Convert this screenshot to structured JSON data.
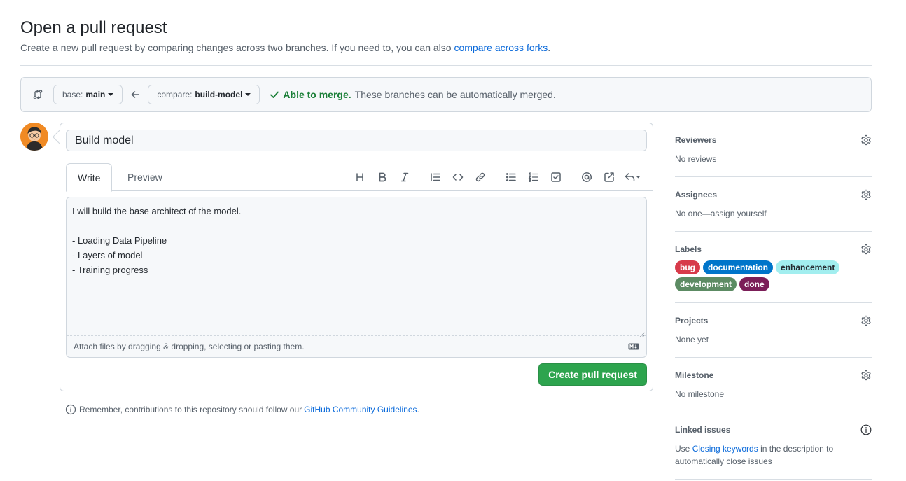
{
  "header": {
    "title": "Open a pull request",
    "subtitle": "Create a new pull request by comparing changes across two branches. If you need to, you can also ",
    "subtitle_link": "compare across forks",
    "subtitle_end": "."
  },
  "range": {
    "base_prefix": "base:",
    "base_branch": "main",
    "compare_prefix": "compare:",
    "compare_branch": "build-model",
    "merge_status": "Able to merge.",
    "merge_message": "These branches can be automatically merged."
  },
  "composer": {
    "title_value": "Build model",
    "tabs": [
      {
        "label": "Write"
      },
      {
        "label": "Preview"
      }
    ],
    "body_value": "I will build the base architect of the model.\n\n- Loading Data Pipeline\n- Layers of model\n- Training progress",
    "attach_hint": "Attach files by dragging & dropping, selecting or pasting them.",
    "submit_label": "Create pull request"
  },
  "toolbar_icons": [
    "heading-icon",
    "bold-icon",
    "italic-icon",
    "quote-icon",
    "code-icon",
    "link-icon",
    "unordered-list-icon",
    "ordered-list-icon",
    "task-list-icon",
    "mention-icon",
    "cross-reference-icon",
    "reply-icon"
  ],
  "tip": {
    "text": "Remember, contributions to this repository should follow our ",
    "link": "GitHub Community Guidelines",
    "end": "."
  },
  "sidebar": {
    "reviewers": {
      "heading": "Reviewers",
      "value": "No reviews"
    },
    "assignees": {
      "heading": "Assignees",
      "value": "No one—assign yourself"
    },
    "labels": {
      "heading": "Labels",
      "items": [
        {
          "name": "bug",
          "bg": "#d73a4a",
          "fg": "#ffffff"
        },
        {
          "name": "documentation",
          "bg": "#0075ca",
          "fg": "#ffffff"
        },
        {
          "name": "enhancement",
          "bg": "#a2eeef",
          "fg": "#24292f"
        },
        {
          "name": "development",
          "bg": "#5c8b63",
          "fg": "#ffffff"
        },
        {
          "name": "done",
          "bg": "#7b1e58",
          "fg": "#ffffff"
        }
      ]
    },
    "projects": {
      "heading": "Projects",
      "value": "None yet"
    },
    "milestone": {
      "heading": "Milestone",
      "value": "No milestone"
    },
    "linked_issues": {
      "heading": "Linked issues",
      "text_before": "Use ",
      "link": "Closing keywords",
      "text_after": " in the description to automatically close issues"
    }
  },
  "colors": {
    "accent": "#0969da",
    "success": "#1a7f37",
    "button_green": "#2da44e"
  }
}
